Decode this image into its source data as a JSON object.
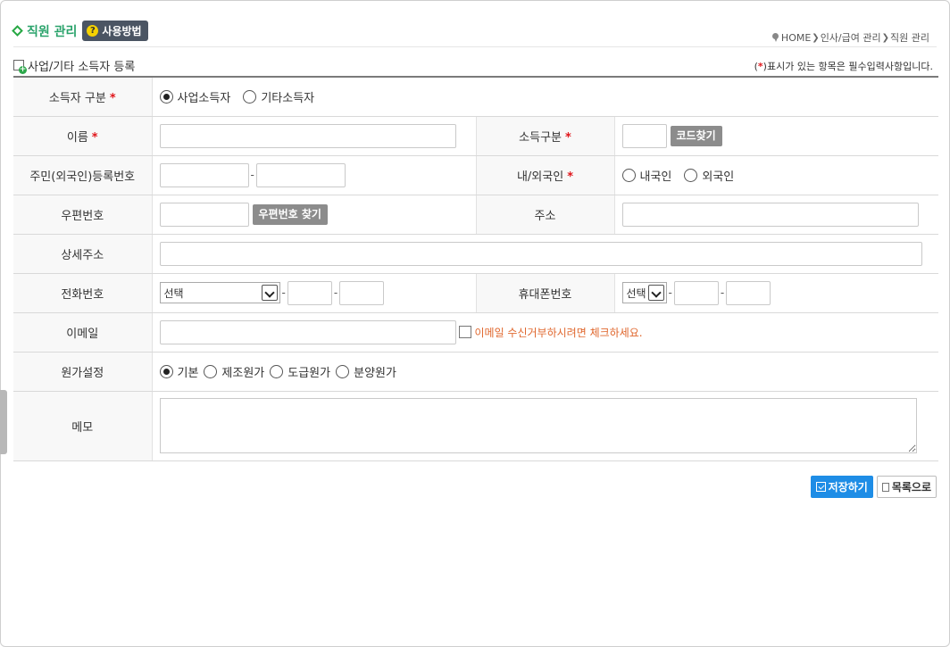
{
  "header": {
    "title": "직원 관리",
    "help_label": "사용방법",
    "help_icon": "?",
    "breadcrumb": [
      "HOME",
      "인사/급여 관리",
      "직원 관리"
    ]
  },
  "section": {
    "title": "사업/기타 소득자 등록",
    "req_prefix": "(",
    "req_star": "*",
    "req_suffix": ")표시가 있는 항목은 필수입력사항입니다."
  },
  "form": {
    "income_type": {
      "label": "소득자 구분",
      "options": [
        "사업소득자",
        "기타소득자"
      ],
      "selected": "사업소득자"
    },
    "name": {
      "label": "이름",
      "value": ""
    },
    "income_code": {
      "label": "소득구분",
      "value": "",
      "button": "코드찾기"
    },
    "resident_no": {
      "label": "주민(외국인)등록번호",
      "part1": "",
      "part2": ""
    },
    "nationality": {
      "label": "내/외국인",
      "options": [
        "내국인",
        "외국인"
      ],
      "selected": ""
    },
    "zipcode": {
      "label": "우편번호",
      "value": "",
      "button": "우편번호 찾기"
    },
    "address": {
      "label": "주소",
      "value": ""
    },
    "address_detail": {
      "label": "상세주소",
      "value": ""
    },
    "phone": {
      "label": "전화번호",
      "select": "선택"
    },
    "mobile": {
      "label": "휴대폰번호",
      "select": "선택"
    },
    "email": {
      "label": "이메일",
      "value": "",
      "optout_label": "이메일 수신거부하시려면 체크하세요."
    },
    "cost_setting": {
      "label": "원가설정",
      "options": [
        "기본",
        "제조원가",
        "도급원가",
        "분양원가"
      ],
      "selected": "기본"
    },
    "memo": {
      "label": "메모",
      "value": ""
    }
  },
  "actions": {
    "save": "저장하기",
    "list": "목록으로"
  },
  "colors": {
    "accent": "#1e8de6",
    "title_green": "#2aa36b",
    "required": "#e0151a",
    "notice": "#e0682f"
  }
}
